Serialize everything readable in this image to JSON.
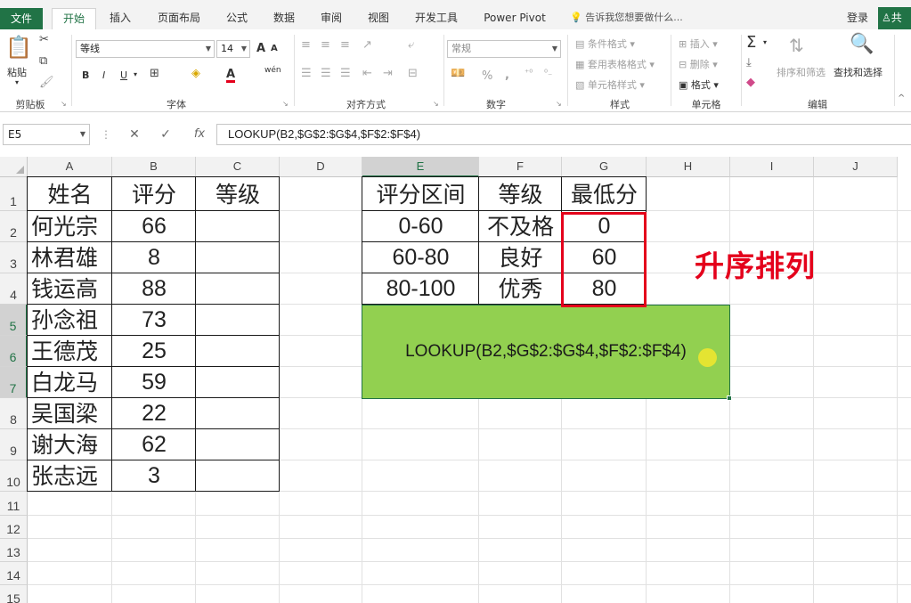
{
  "tabs": {
    "file": "文件",
    "items": [
      "开始",
      "插入",
      "页面布局",
      "公式",
      "数据",
      "审阅",
      "视图",
      "开发工具",
      "Power Pivot"
    ],
    "active_index": 0,
    "tell_me": "告诉我您想要做什么...",
    "login": "登录",
    "share": "共"
  },
  "ribbon": {
    "clipboard": {
      "paste": "粘贴",
      "label": "剪贴板"
    },
    "font": {
      "name": "等线",
      "size": "14",
      "bold": "B",
      "italic": "I",
      "underline": "U",
      "grow": "A",
      "shrink": "A",
      "color_a": "A",
      "wen": "wén",
      "label": "字体"
    },
    "alignment": {
      "label": "对齐方式"
    },
    "number": {
      "format": "常规",
      "percent": "%",
      "comma": ",",
      "label": "数字"
    },
    "styles": {
      "conditional": "条件格式",
      "table": "套用表格格式",
      "cell": "单元格样式",
      "label": "样式"
    },
    "cells": {
      "insert": "插入",
      "delete": "删除",
      "format": "格式",
      "label": "单元格"
    },
    "editing": {
      "sigma": "Σ",
      "sort": "排序和筛选",
      "find": "查找和选择",
      "label": "编辑"
    }
  },
  "formula_bar": {
    "name_box": "E5",
    "cancel": "✕",
    "enter": "✓",
    "fx": "fx",
    "formula": "LOOKUP(B2,$G$2:$G$4,$F$2:$F$4)"
  },
  "columns": [
    "A",
    "B",
    "C",
    "D",
    "E",
    "F",
    "G",
    "H",
    "I",
    "J"
  ],
  "rows": [
    "1",
    "2",
    "3",
    "4",
    "5",
    "6",
    "7",
    "8",
    "9",
    "10",
    "11",
    "12",
    "13",
    "14",
    "15"
  ],
  "table1": {
    "headers": [
      "姓名",
      "评分",
      "等级"
    ],
    "rows": [
      [
        "何光宗",
        "66",
        ""
      ],
      [
        "林君雄",
        "8",
        ""
      ],
      [
        "钱运高",
        "88",
        ""
      ],
      [
        "孙念祖",
        "73",
        ""
      ],
      [
        "王德茂",
        "25",
        ""
      ],
      [
        "白龙马",
        "59",
        ""
      ],
      [
        "吴国梁",
        "22",
        ""
      ],
      [
        "谢大海",
        "62",
        ""
      ],
      [
        "张志远",
        "3",
        ""
      ]
    ]
  },
  "table2": {
    "headers": [
      "评分区间",
      "等级",
      "最低分"
    ],
    "rows": [
      [
        "0-60",
        "不及格",
        "0"
      ],
      [
        "60-80",
        "良好",
        "60"
      ],
      [
        "80-100",
        "优秀",
        "80"
      ]
    ]
  },
  "annotation": "升序排列",
  "green_box_text": "LOOKUP(B2,$G$2:$G$4,$F$2:$F$4)",
  "colors": {
    "excel_green": "#217346",
    "highlight_green": "#92d050",
    "annotation_red": "#e4001b"
  }
}
